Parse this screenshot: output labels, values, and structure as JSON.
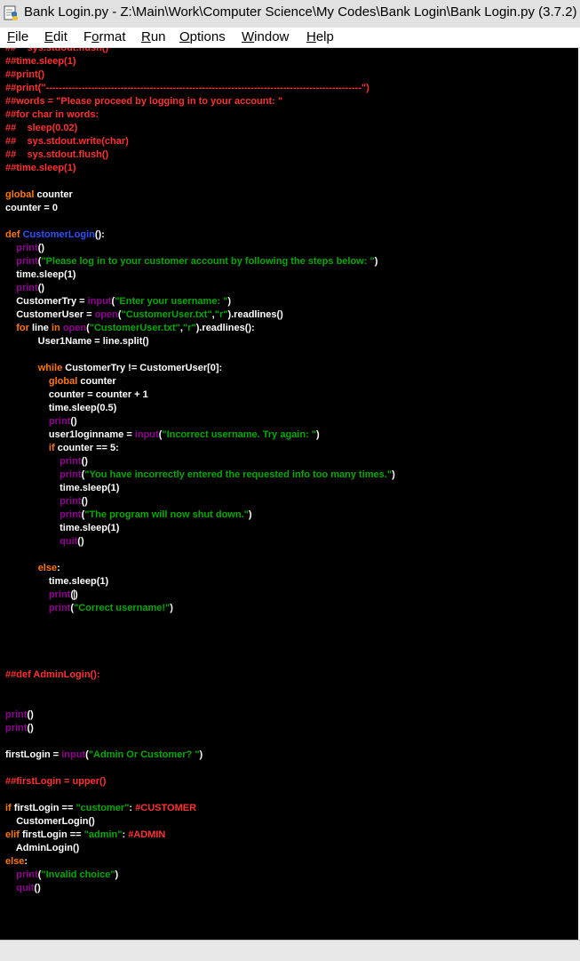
{
  "window": {
    "title": "Bank Login.py - Z:\\Main\\Work\\Computer Science\\My Codes\\Bank Login\\Bank Login.py (3.7.2)",
    "icon": "python-idle-icon"
  },
  "menu": [
    {
      "pre": "",
      "mn": "F",
      "post": "ile"
    },
    {
      "pre": "",
      "mn": "E",
      "post": "dit"
    },
    {
      "pre": "F",
      "mn": "o",
      "post": "rmat"
    },
    {
      "pre": "",
      "mn": "R",
      "post": "un"
    },
    {
      "pre": "",
      "mn": "O",
      "post": "ptions"
    },
    {
      "pre": "",
      "mn": "W",
      "post": "indow"
    },
    {
      "pre": "",
      "mn": "H",
      "post": "elp"
    }
  ],
  "colors": {
    "comment": "#ff3030",
    "keyword": "#ff7700",
    "builtin": "#900090",
    "string": "#00aa00",
    "defname": "#3050ff",
    "normal": "#ffffff",
    "background": "#000000"
  },
  "code_lines": [
    [
      [
        "comment",
        "##    sys.stdout.flush()"
      ]
    ],
    [
      [
        "comment",
        "##time.sleep(1)"
      ]
    ],
    [
      [
        "comment",
        "##print()"
      ]
    ],
    [
      [
        "comment",
        "##print(\"-------------------------------------------------------------------------------------------------\")"
      ]
    ],
    [
      [
        "comment",
        "##words = \"Please proceed by logging in to your account: \""
      ]
    ],
    [
      [
        "comment",
        "##for char in words:"
      ]
    ],
    [
      [
        "comment",
        "##    sleep(0.02)"
      ]
    ],
    [
      [
        "comment",
        "##    sys.stdout.write(char)"
      ]
    ],
    [
      [
        "comment",
        "##    sys.stdout.flush()"
      ]
    ],
    [
      [
        "comment",
        "##time.sleep(1)"
      ]
    ],
    [],
    [
      [
        "keyword",
        "global"
      ],
      [
        "normal",
        " counter"
      ]
    ],
    [
      [
        "normal",
        "counter = 0"
      ]
    ],
    [],
    [
      [
        "keyword",
        "def"
      ],
      [
        "normal",
        " "
      ],
      [
        "defname",
        "CustomerLogin"
      ],
      [
        "normal",
        "():"
      ]
    ],
    [
      [
        "normal",
        "    "
      ],
      [
        "builtin",
        "print"
      ],
      [
        "normal",
        "()"
      ]
    ],
    [
      [
        "normal",
        "    "
      ],
      [
        "builtin",
        "print"
      ],
      [
        "normal",
        "("
      ],
      [
        "string",
        "\"Please log in to your customer account by following the steps below: \""
      ],
      [
        "normal",
        ")"
      ]
    ],
    [
      [
        "normal",
        "    time.sleep(1)"
      ]
    ],
    [
      [
        "normal",
        "    "
      ],
      [
        "builtin",
        "print"
      ],
      [
        "normal",
        "()"
      ]
    ],
    [
      [
        "normal",
        "    CustomerTry = "
      ],
      [
        "builtin",
        "input"
      ],
      [
        "normal",
        "("
      ],
      [
        "string",
        "\"Enter your username: \""
      ],
      [
        "normal",
        ")"
      ]
    ],
    [
      [
        "normal",
        "    CustomerUser = "
      ],
      [
        "builtin",
        "open"
      ],
      [
        "normal",
        "("
      ],
      [
        "string",
        "\"CustomerUser.txt\""
      ],
      [
        "normal",
        ","
      ],
      [
        "string",
        "\"r\""
      ],
      [
        "normal",
        ").readlines()"
      ]
    ],
    [
      [
        "normal",
        "    "
      ],
      [
        "keyword",
        "for"
      ],
      [
        "normal",
        " line "
      ],
      [
        "keyword",
        "in"
      ],
      [
        "normal",
        " "
      ],
      [
        "builtin",
        "open"
      ],
      [
        "normal",
        "("
      ],
      [
        "string",
        "\"CustomerUser.txt\""
      ],
      [
        "normal",
        ","
      ],
      [
        "string",
        "\"r\""
      ],
      [
        "normal",
        ").readlines():"
      ]
    ],
    [
      [
        "normal",
        "            User1Name = line.split()"
      ]
    ],
    [],
    [
      [
        "normal",
        "            "
      ],
      [
        "keyword",
        "while"
      ],
      [
        "normal",
        " CustomerTry != CustomerUser[0]:"
      ]
    ],
    [
      [
        "normal",
        "                "
      ],
      [
        "keyword",
        "global"
      ],
      [
        "normal",
        " counter"
      ]
    ],
    [
      [
        "normal",
        "                counter = counter + 1"
      ]
    ],
    [
      [
        "normal",
        "                time.sleep(0.5)"
      ]
    ],
    [
      [
        "normal",
        "                "
      ],
      [
        "builtin",
        "print"
      ],
      [
        "normal",
        "()"
      ]
    ],
    [
      [
        "normal",
        "                user1loginname = "
      ],
      [
        "builtin",
        "input"
      ],
      [
        "normal",
        "("
      ],
      [
        "string",
        "\"Incorrect username. Try again: \""
      ],
      [
        "normal",
        ")"
      ]
    ],
    [
      [
        "normal",
        "                "
      ],
      [
        "keyword",
        "if"
      ],
      [
        "normal",
        " counter == 5:"
      ]
    ],
    [
      [
        "normal",
        "                    "
      ],
      [
        "builtin",
        "print"
      ],
      [
        "normal",
        "()"
      ]
    ],
    [
      [
        "normal",
        "                    "
      ],
      [
        "builtin",
        "print"
      ],
      [
        "normal",
        "("
      ],
      [
        "string",
        "\"You have incorrectly entered the requested info too many times.\""
      ],
      [
        "normal",
        ")"
      ]
    ],
    [
      [
        "normal",
        "                    time.sleep(1)"
      ]
    ],
    [
      [
        "normal",
        "                    "
      ],
      [
        "builtin",
        "print"
      ],
      [
        "normal",
        "()"
      ]
    ],
    [
      [
        "normal",
        "                    "
      ],
      [
        "builtin",
        "print"
      ],
      [
        "normal",
        "("
      ],
      [
        "string",
        "\"The program will now shut down.\""
      ],
      [
        "normal",
        ")"
      ]
    ],
    [
      [
        "normal",
        "                    time.sleep(1)"
      ]
    ],
    [
      [
        "normal",
        "                    "
      ],
      [
        "builtin",
        "quit"
      ],
      [
        "normal",
        "()"
      ]
    ],
    [],
    [
      [
        "normal",
        "            "
      ],
      [
        "keyword",
        "else"
      ],
      [
        "normal",
        ":"
      ]
    ],
    [
      [
        "normal",
        "                time.sleep(1)"
      ]
    ],
    [
      [
        "normal",
        "                "
      ],
      [
        "builtin",
        "print"
      ],
      [
        "normal",
        "("
      ],
      [
        "caret",
        ""
      ],
      [
        "normal",
        ")"
      ]
    ],
    [
      [
        "normal",
        "                "
      ],
      [
        "builtin",
        "print"
      ],
      [
        "normal",
        "("
      ],
      [
        "string",
        "\"Correct username!\""
      ],
      [
        "normal",
        ")"
      ]
    ],
    [],
    [],
    [],
    [],
    [
      [
        "comment",
        "##def AdminLogin():"
      ]
    ],
    [],
    [],
    [
      [
        "builtin",
        "print"
      ],
      [
        "normal",
        "()"
      ]
    ],
    [
      [
        "builtin",
        "print"
      ],
      [
        "normal",
        "()"
      ]
    ],
    [],
    [
      [
        "normal",
        "firstLogin = "
      ],
      [
        "builtin",
        "input"
      ],
      [
        "normal",
        "("
      ],
      [
        "string",
        "\"Admin Or Customer? \""
      ],
      [
        "normal",
        ")"
      ]
    ],
    [],
    [
      [
        "comment",
        "##firstLogin = upper()"
      ]
    ],
    [],
    [
      [
        "keyword",
        "if"
      ],
      [
        "normal",
        " firstLogin == "
      ],
      [
        "string",
        "\"customer\""
      ],
      [
        "normal",
        ": "
      ],
      [
        "comment",
        "#CUSTOMER"
      ]
    ],
    [
      [
        "normal",
        "    CustomerLogin()"
      ]
    ],
    [
      [
        "keyword",
        "elif"
      ],
      [
        "normal",
        " firstLogin == "
      ],
      [
        "string",
        "\"admin\""
      ],
      [
        "normal",
        ": "
      ],
      [
        "comment",
        "#ADMIN"
      ]
    ],
    [
      [
        "normal",
        "    AdminLogin()"
      ]
    ],
    [
      [
        "keyword",
        "else"
      ],
      [
        "normal",
        ":"
      ]
    ],
    [
      [
        "normal",
        "    "
      ],
      [
        "builtin",
        "print"
      ],
      [
        "normal",
        "("
      ],
      [
        "string",
        "\"Invalid choice\""
      ],
      [
        "normal",
        ")"
      ]
    ],
    [
      [
        "normal",
        "    "
      ],
      [
        "builtin",
        "quit"
      ],
      [
        "normal",
        "()"
      ]
    ]
  ]
}
